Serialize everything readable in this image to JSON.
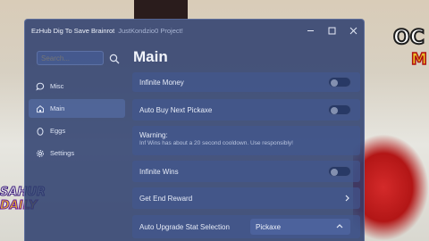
{
  "window": {
    "title": "EzHub Dig To Save Brainrot",
    "subtitle": "JustKondzio0 Project!"
  },
  "sidebar": {
    "search_placeholder": "Search...",
    "items": [
      {
        "label": "Misc",
        "icon": "chat-bubble-icon"
      },
      {
        "label": "Main",
        "icon": "home-icon",
        "active": true
      },
      {
        "label": "Eggs",
        "icon": "egg-icon"
      },
      {
        "label": "Settings",
        "icon": "gear-icon"
      }
    ]
  },
  "main": {
    "title": "Main",
    "rows": {
      "infinite_money": {
        "label": "Infinite Money",
        "toggle": false
      },
      "auto_buy_pickaxe": {
        "label": "Auto Buy Next Pickaxe",
        "toggle": false
      },
      "warning": {
        "title": "Warning:",
        "text": "Inf Wins has about a 20 second cooldown. Use responsibly!"
      },
      "infinite_wins": {
        "label": "Infinite Wins",
        "toggle": false
      },
      "get_end_reward": {
        "label": "Get End Reward"
      },
      "auto_upgrade": {
        "label": "Auto Upgrade Stat Selection",
        "value": "Pickaxe"
      }
    }
  },
  "background": {
    "top_right_text": "OC",
    "top_right_text2": "M",
    "left_text_1": "SAHUR",
    "left_text_2": "DAILY"
  },
  "colors": {
    "window_bg": "#2c3e6e",
    "row_bg": "#425891",
    "accent": "#5a73af"
  }
}
